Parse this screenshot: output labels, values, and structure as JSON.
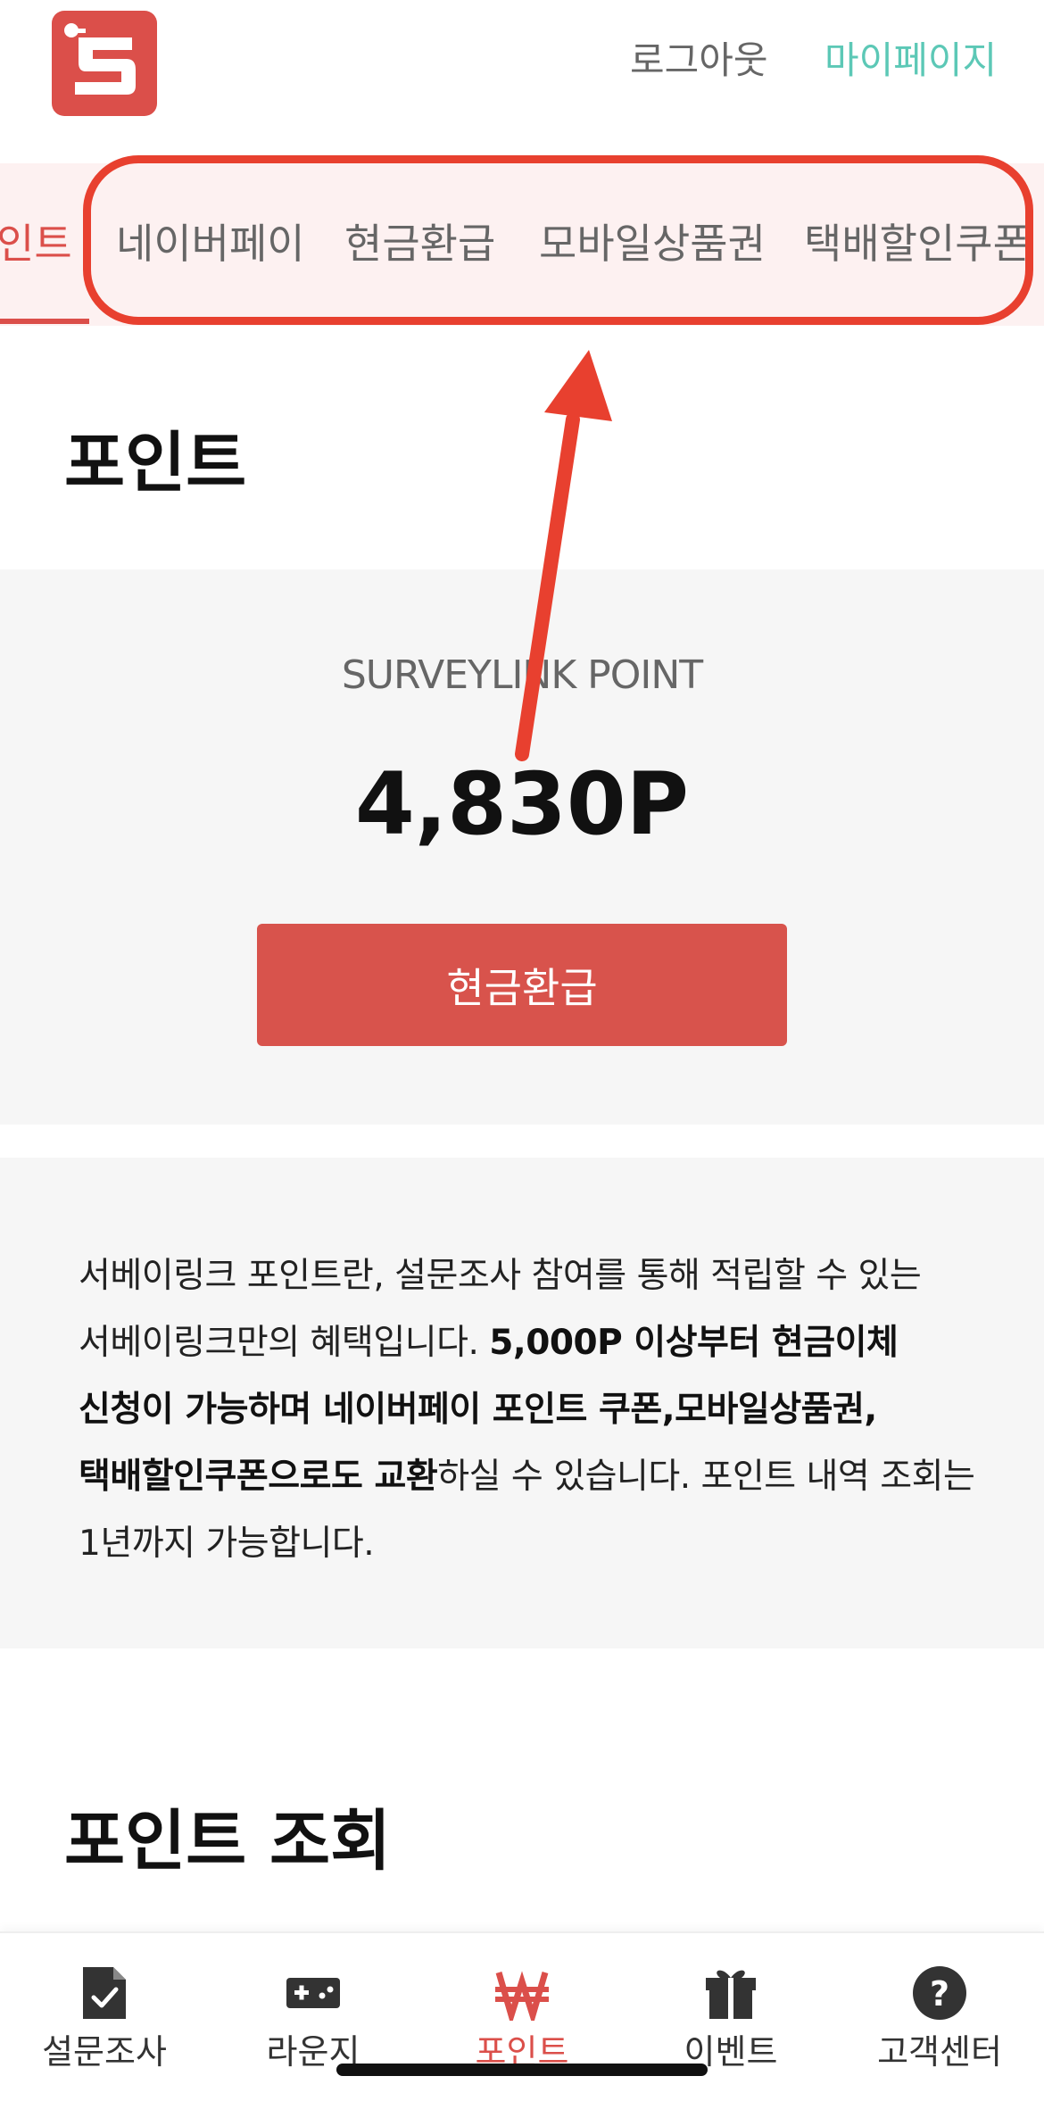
{
  "header": {
    "logo_icon": "surveylink-logo",
    "logout_label": "로그아웃",
    "mypage_label": "마이페이지"
  },
  "tabs": [
    {
      "label": "인트",
      "active": true
    },
    {
      "label": "네이버페이",
      "active": false
    },
    {
      "label": "현금환급",
      "active": false
    },
    {
      "label": "모바일상품권",
      "active": false
    },
    {
      "label": "택배할인쿠폰",
      "active": false
    }
  ],
  "page_title": "포인트",
  "point_panel": {
    "brand_label": "SURVEYLINK POINT",
    "point_value": "4,830P",
    "refund_button_label": "현금환급"
  },
  "info": {
    "part1": "서베이링크 포인트란, 설문조사 참여를 통해 적립할 수 있는 서베이링크만의 혜택입니다. ",
    "part2_bold": "5,000P 이상부터 현금이체 신청이 가능하며 네이버페이 포인트 쿠폰,모바일상품권, 택배할인쿠폰으로도 교환",
    "part3": "하실 수 있습니다. 포인트 내역 조회는 1년까지 가능합니다."
  },
  "history_title": "포인트 조회",
  "bottom_nav": [
    {
      "label": "설문조사",
      "icon": "survey-icon",
      "active": false
    },
    {
      "label": "라운지",
      "icon": "gamepad-icon",
      "active": false
    },
    {
      "label": "포인트",
      "icon": "won-icon",
      "active": true
    },
    {
      "label": "이벤트",
      "icon": "gift-icon",
      "active": false
    },
    {
      "label": "고객센터",
      "icon": "help-icon",
      "active": false
    }
  ],
  "colors": {
    "brand_red": "#db4f4a",
    "mypage_teal": "#5cc8b6",
    "annotation_red": "#e8402f"
  }
}
